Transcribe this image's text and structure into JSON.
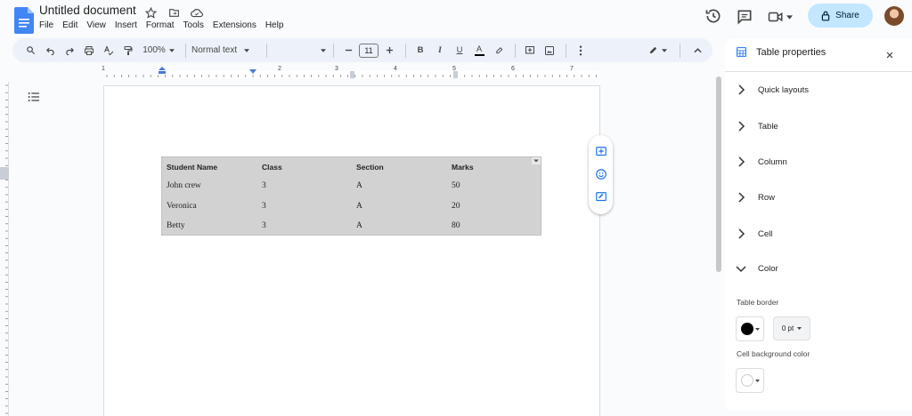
{
  "header": {
    "doc_title": "Untitled document",
    "menu": [
      "File",
      "Edit",
      "View",
      "Insert",
      "Format",
      "Tools",
      "Extensions",
      "Help"
    ],
    "share_label": "Share"
  },
  "toolbar": {
    "zoom": "100%",
    "style": "Normal text",
    "font_size": "11",
    "bold": "B",
    "italic": "I",
    "underline": "U",
    "text_color": "A"
  },
  "ruler": {
    "numbers": [
      "1",
      "2",
      "3",
      "4",
      "5",
      "6",
      "7"
    ]
  },
  "table": {
    "headers": [
      "Student Name",
      "Class",
      "Section",
      "Marks"
    ],
    "rows": [
      [
        "John crew",
        "3",
        "A",
        "50"
      ],
      [
        "Veronica",
        "3",
        "A",
        "20"
      ],
      [
        "Betty",
        "3",
        "A",
        "80"
      ]
    ],
    "background": "#d2d2d2"
  },
  "panel": {
    "title": "Table properties",
    "sections": [
      "Quick layouts",
      "Table",
      "Column",
      "Row",
      "Cell",
      "Color"
    ],
    "table_border_label": "Table border",
    "border_width": "0 pt",
    "cell_bg_label": "Cell background color",
    "border_color": "#000000"
  },
  "colors": {
    "accent": "#c2e7ff",
    "toolbar_bg": "#edf2fa",
    "doc_icon": "#4285f4"
  },
  "icons": [
    "docs-logo-icon",
    "star-icon",
    "move-folder-icon",
    "cloud-saved-icon",
    "history-icon",
    "comments-icon",
    "meet-icon",
    "lock-icon",
    "search-icon",
    "undo-icon",
    "redo-icon",
    "print-icon",
    "spellcheck-icon",
    "paint-format-icon",
    "highlight-icon",
    "insert-comment-icon",
    "insert-image-icon",
    "more-icon",
    "edit-mode-icon",
    "collapse-icon",
    "outline-icon",
    "add-comment-icon",
    "emoji-icon",
    "suggest-edit-icon",
    "table-icon",
    "close-icon",
    "chevron-right-icon",
    "chevron-down-icon"
  ]
}
